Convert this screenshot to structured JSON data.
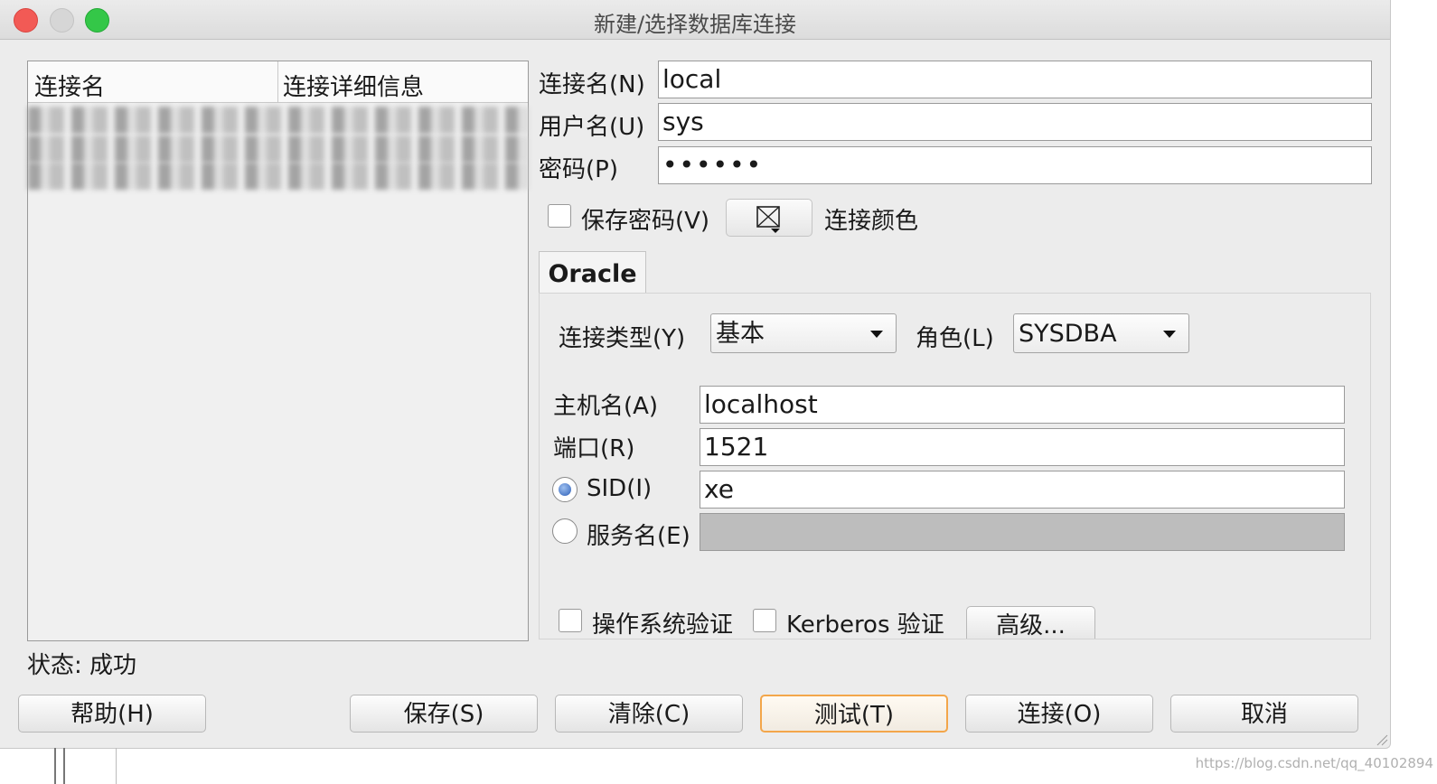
{
  "window": {
    "title": "新建/选择数据库连接"
  },
  "connection_list": {
    "headers": [
      "连接名",
      "连接详细信息"
    ],
    "rows_obscured": 3
  },
  "form": {
    "conn_name_label": "连接名(N)",
    "conn_name_value": "local",
    "user_label": "用户名(U)",
    "user_value": "sys",
    "password_label": "密码(P)",
    "password_value": "••••••",
    "save_password_label": "保存密码(V)",
    "save_password_checked": false,
    "color_icon": "color-picker-icon",
    "conn_color_label": "连接颜色"
  },
  "tab": {
    "label": "Oracle"
  },
  "oracle": {
    "conn_type_label": "连接类型(Y)",
    "conn_type_value": "基本",
    "role_label": "角色(L)",
    "role_value": "SYSDBA",
    "host_label": "主机名(A)",
    "host_value": "localhost",
    "port_label": "端口(R)",
    "port_value": "1521",
    "sid_label": "SID(I)",
    "sid_value": "xe",
    "sid_selected": true,
    "service_label": "服务名(E)",
    "service_value": "",
    "os_auth_label": "操作系统验证",
    "kerberos_label": "Kerberos 验证",
    "advanced_label": "高级..."
  },
  "status": {
    "text": "状态: 成功"
  },
  "buttons": {
    "help": "帮助(H)",
    "save": "保存(S)",
    "clear": "清除(C)",
    "test": "测试(T)",
    "connect": "连接(O)",
    "cancel": "取消"
  },
  "watermark": "https://blog.csdn.net/qq_40102894"
}
